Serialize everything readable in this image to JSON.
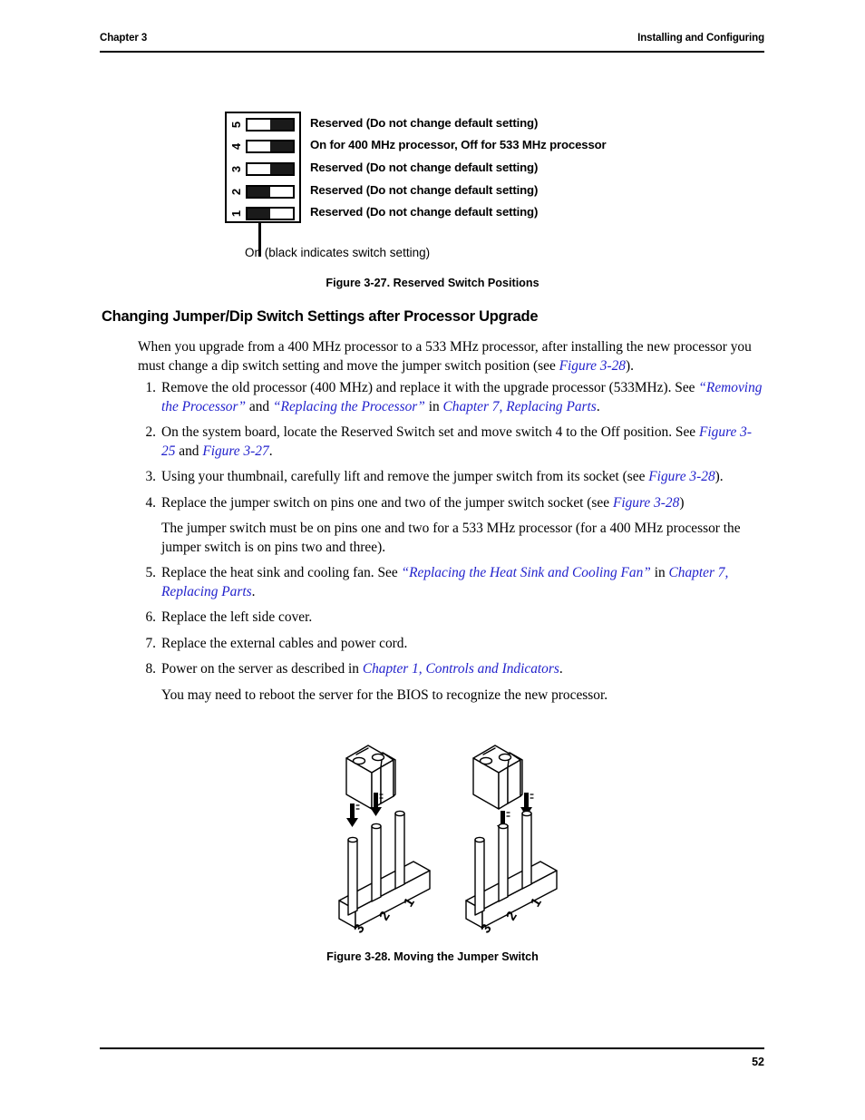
{
  "header": {
    "left": "Chapter 3",
    "right": "Installing and Configuring"
  },
  "footer": {
    "page_number": "52"
  },
  "figure_327": {
    "caption": "Figure 3-27.  Reserved Switch Positions",
    "callout_label": "On (black indicates switch setting)",
    "switches": [
      {
        "number": "5",
        "left_state": "off",
        "right_state": "on",
        "label": "Reserved (Do not change default setting)"
      },
      {
        "number": "4",
        "left_state": "off",
        "right_state": "on",
        "label": "On for 400 MHz processor, Off for 533 MHz processor"
      },
      {
        "number": "3",
        "left_state": "off",
        "right_state": "on",
        "label": "Reserved (Do not change default setting)"
      },
      {
        "number": "2",
        "left_state": "on",
        "right_state": "off",
        "label": "Reserved (Do not change default setting)"
      },
      {
        "number": "1",
        "left_state": "on",
        "right_state": "off",
        "label": "Reserved (Do not change default setting)"
      }
    ]
  },
  "section": {
    "heading": "Changing Jumper/Dip Switch Settings after Processor Upgrade",
    "intro": {
      "part1": "When you upgrade from a 400 MHz processor to a 533 MHz processor, after installing the new processor you must change a dip switch setting and move the jumper switch position (see ",
      "xref1": "Figure 3-28",
      "part2": ")."
    }
  },
  "steps": [
    {
      "number": "1.",
      "segments": [
        {
          "text": "Remove the old processor (400 MHz) and replace it with the upgrade processor (533MHz). See ",
          "style": "plain"
        },
        {
          "text": "“Removing the Processor”",
          "style": "xref"
        },
        {
          "text": " and ",
          "style": "plain"
        },
        {
          "text": "“Replacing the Processor”",
          "style": "xref"
        },
        {
          "text": "  in ",
          "style": "plain"
        },
        {
          "text": "Chapter 7, Replacing Parts",
          "style": "xref"
        },
        {
          "text": ".",
          "style": "plain"
        }
      ]
    },
    {
      "number": "2.",
      "segments": [
        {
          "text": "On the system board, locate the Reserved Switch set and move switch 4 to the Off position. See ",
          "style": "plain"
        },
        {
          "text": "Figure 3-25",
          "style": "xref"
        },
        {
          "text": " and ",
          "style": "plain"
        },
        {
          "text": "Figure 3-27",
          "style": "xref"
        },
        {
          "text": ".",
          "style": "plain"
        }
      ]
    },
    {
      "number": "3.",
      "segments": [
        {
          "text": "Using your thumbnail, carefully lift and remove the jumper switch from its socket (see ",
          "style": "plain"
        },
        {
          "text": "Figure 3-28",
          "style": "xref"
        },
        {
          "text": ").",
          "style": "plain"
        }
      ]
    },
    {
      "number": "4.",
      "segments": [
        {
          "text": "Replace the jumper switch on pins one and two of the jumper switch socket (see ",
          "style": "plain"
        },
        {
          "text": "Figure 3-28",
          "style": "xref"
        },
        {
          "text": ")",
          "style": "plain"
        }
      ]
    },
    {
      "number": "",
      "segments": [
        {
          "text": "The jumper switch must be on pins one and two for a 533 MHz processor (for a 400 MHz processor the jumper switch is on pins two and three).",
          "style": "plain"
        }
      ]
    },
    {
      "number": "5.",
      "segments": [
        {
          "text": "Replace the heat sink and cooling fan. See ",
          "style": "plain"
        },
        {
          "text": "“Replacing the Heat Sink and Cooling Fan”",
          "style": "xref"
        },
        {
          "text": "  in ",
          "style": "plain"
        },
        {
          "text": "Chapter 7, Replacing Parts",
          "style": "xref"
        },
        {
          "text": ".",
          "style": "plain"
        }
      ]
    },
    {
      "number": "6.",
      "segments": [
        {
          "text": "Replace the left side cover.",
          "style": "plain"
        }
      ]
    },
    {
      "number": "7.",
      "segments": [
        {
          "text": "Replace the external cables and power cord.",
          "style": "plain"
        }
      ]
    },
    {
      "number": "8.",
      "segments": [
        {
          "text": "Power on the server as described in ",
          "style": "plain"
        },
        {
          "text": "Chapter 1, Controls and Indicators",
          "style": "xref"
        },
        {
          "text": ".",
          "style": "plain"
        }
      ]
    },
    {
      "number": "",
      "segments": [
        {
          "text": "You may need to reboot the server for the BIOS to recognize the new processor.",
          "style": "plain"
        }
      ]
    }
  ],
  "figure_328": {
    "caption": "Figure 3-28.  Moving the Jumper Switch",
    "diagrams": [
      {
        "name": "400-mhz-position",
        "pin_labels": [
          "3",
          "2",
          "1"
        ],
        "jumper_on_pins": [
          "3",
          "2"
        ]
      },
      {
        "name": "533-mhz-position",
        "pin_labels": [
          "3",
          "2",
          "1"
        ],
        "jumper_on_pins": [
          "2",
          "1"
        ]
      }
    ]
  },
  "colors": {
    "link": "#2222cc",
    "switch_on": "#1a1a1a",
    "rule": "#000000"
  }
}
